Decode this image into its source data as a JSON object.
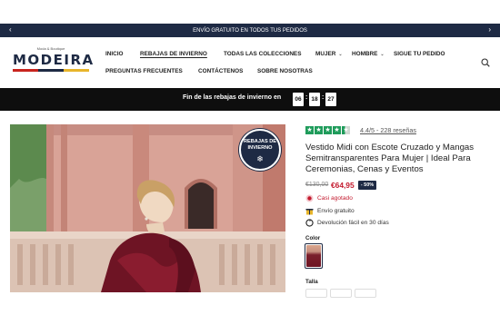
{
  "announcement": {
    "text": "ENVÍO GRATUITO EN TODOS TUS PEDIDOS"
  },
  "brand": {
    "tagline": "Moda & Boutique",
    "name": "MODEIRA"
  },
  "nav": {
    "row1": [
      "INICIO",
      "REBAJAS DE INVIERNO",
      "TODAS LAS COLECCIONES",
      "MUJER",
      "HOMBRE",
      "SIGUE TU PEDIDO"
    ],
    "row2": [
      "PREGUNTAS FRECUENTES",
      "CONTÁCTENOS",
      "SOBRE NOSOTRAS"
    ],
    "active": "REBAJAS DE INVIERNO"
  },
  "countdown": {
    "label": "Fin de las rebajas de invierno en",
    "hours": "06",
    "minutes": "18",
    "seconds": "27"
  },
  "badge": {
    "line1": "REBAJAS DE",
    "line2": "INVIERNO"
  },
  "product": {
    "rating": 4.4,
    "rating_text": "4.4/5 - 228 reseñas",
    "title": "Vestido Midi con Escote Cruzado y Mangas Semitransparentes Para Mujer | Ideal Para Ceremonias, Cenas y Eventos",
    "old_price": "€130,00",
    "price": "€64,95",
    "discount": "- 50%",
    "features": [
      "Casi agotado",
      "Envío gratuito",
      "Devolución fácil en 30 días"
    ],
    "color_label": "Color",
    "size_label": "Talla"
  },
  "colors": {
    "navy": "#1e2a44",
    "price_red": "#c31a2e",
    "rating_green": "#1f9c5b",
    "dress_wine": "#6e1424"
  },
  "icons": [
    "chevron-left-icon",
    "chevron-right-icon",
    "search-icon",
    "star-icon",
    "snowflake-icon",
    "stock-dot-icon",
    "gift-icon",
    "return-icon"
  ]
}
